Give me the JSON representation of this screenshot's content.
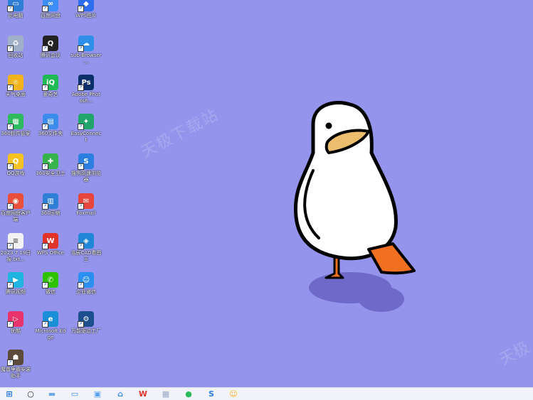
{
  "desktop": {
    "icons": [
      {
        "label": "此电脑",
        "color": "#2f7fd6",
        "glyph": "▭"
      },
      {
        "label": "百度网盘",
        "color": "#3a8ef5",
        "glyph": "∞"
      },
      {
        "label": "WPS图片",
        "color": "#2e6cf0",
        "glyph": "◆"
      },
      {
        "label": "回收站",
        "color": "#9fb0c8",
        "glyph": "♻"
      },
      {
        "label": "腾讯会议",
        "color": "#222222",
        "glyph": "Q"
      },
      {
        "label": "sub-Browser-...",
        "color": "#2f8fe8",
        "glyph": "☁"
      },
      {
        "label": "天气桌面",
        "color": "#f2b31d",
        "glyph": "☼"
      },
      {
        "label": "爱奇艺",
        "color": "#1fba55",
        "glyph": "iQ"
      },
      {
        "label": "Adobe Photosh...",
        "color": "#0a2f6b",
        "glyph": "Ps"
      },
      {
        "label": "360软件管家",
        "color": "#2dbb5e",
        "glyph": "▦"
      },
      {
        "label": "360文件夹",
        "color": "#3b8bea",
        "glyph": "▤"
      },
      {
        "label": "EasyConnect",
        "color": "#21a56a",
        "glyph": "✦"
      },
      {
        "label": "QQ游戏",
        "color": "#f4c223",
        "glyph": "Q"
      },
      {
        "label": "360安全卫士",
        "color": "#36b34a",
        "glyph": "✚"
      },
      {
        "label": "搜狗高速浏览器",
        "color": "#2b7fe0",
        "glyph": "S"
      },
      {
        "label": "百度网盘客户端",
        "color": "#e94f3a",
        "glyph": "◉"
      },
      {
        "label": "360压缩",
        "color": "#2f7fd6",
        "glyph": "▥"
      },
      {
        "label": "Foxmail",
        "color": "#e8453c",
        "glyph": "✉"
      },
      {
        "label": "2023.7.19日报.txt...",
        "color": "#f2f2f2",
        "glyph": "≡"
      },
      {
        "label": "WPS Office",
        "color": "#e2332b",
        "glyph": "W"
      },
      {
        "label": "浩辰CAD看图王",
        "color": "#1f86d8",
        "glyph": "◈"
      },
      {
        "label": "腾讯视频",
        "color": "#1fb5e0",
        "glyph": "▶"
      },
      {
        "label": "微信",
        "color": "#2dc100",
        "glyph": "✆"
      },
      {
        "label": "企业微信",
        "color": "#2a8ff0",
        "glyph": "☺"
      },
      {
        "label": "优酷",
        "color": "#e8336d",
        "glyph": "▷"
      },
      {
        "label": "Microsoft Edge",
        "color": "#1a8fd8",
        "glyph": "e"
      },
      {
        "label": "万能驱动工厂",
        "color": "#1d4f8f",
        "glyph": "⚙"
      },
      {
        "label": "魔兽争霸安装助手",
        "color": "#5c4a3a",
        "glyph": "☗"
      }
    ],
    "watermark": "天极下载站",
    "watermark_2": "天极"
  },
  "taskbar": {
    "items": [
      {
        "name": "start-button",
        "color": "#1a6fd6",
        "glyph": "⊞"
      },
      {
        "name": "search-button",
        "color": "#222222",
        "glyph": "○"
      },
      {
        "name": "taskbar-file-explorer",
        "color": "#6fa8e8",
        "glyph": "▬"
      },
      {
        "name": "taskbar-folder",
        "color": "#3a8fe8",
        "glyph": "▭"
      },
      {
        "name": "taskbar-media",
        "color": "#5aa0f0",
        "glyph": "▣"
      },
      {
        "name": "taskbar-baidu-netdisk",
        "color": "#3a8ef5",
        "glyph": "⌂"
      },
      {
        "name": "taskbar-wps",
        "color": "#e2332b",
        "glyph": "W"
      },
      {
        "name": "taskbar-app",
        "color": "#9aa9c4",
        "glyph": "▦"
      },
      {
        "name": "taskbar-chrome",
        "color": "#2dba5a",
        "glyph": "●"
      },
      {
        "name": "taskbar-sogou",
        "color": "#2b7fe0",
        "glyph": "S"
      },
      {
        "name": "taskbar-photos",
        "color": "#f2b31d",
        "glyph": "☺"
      }
    ]
  }
}
